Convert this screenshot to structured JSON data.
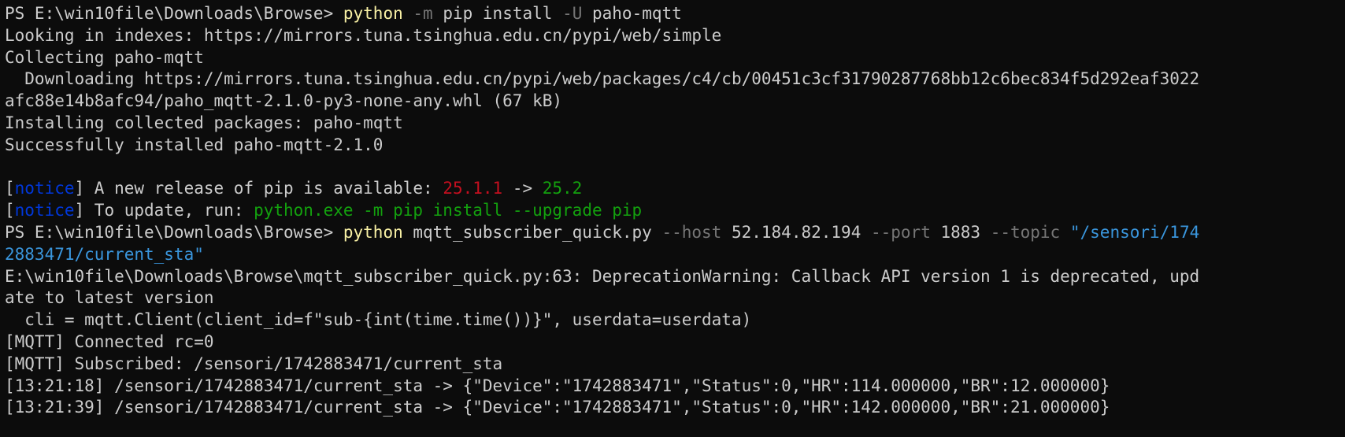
{
  "terminal": {
    "colors": {
      "default": "#cccccc",
      "command": "#f9f1a5",
      "param": "#767676",
      "string": "#3a96dd",
      "notice": "#0037da",
      "old_version": "#c50f1f",
      "new_version": "#13a10e",
      "update_cmd": "#13a10e"
    },
    "lines": [
      [
        {
          "text": "PS E:\\win10file\\Downloads\\Browse> ",
          "color": "#cccccc"
        },
        {
          "text": "python",
          "color": "#f9f1a5"
        },
        {
          "text": " ",
          "color": "#cccccc"
        },
        {
          "text": "-m",
          "color": "#767676"
        },
        {
          "text": " pip install ",
          "color": "#cccccc"
        },
        {
          "text": "-U",
          "color": "#767676"
        },
        {
          "text": " paho-mqtt",
          "color": "#cccccc"
        }
      ],
      [
        {
          "text": "Looking in indexes: https://mirrors.tuna.tsinghua.edu.cn/pypi/web/simple",
          "color": "#cccccc"
        }
      ],
      [
        {
          "text": "Collecting paho-mqtt",
          "color": "#cccccc"
        }
      ],
      [
        {
          "text": "  Downloading https://mirrors.tuna.tsinghua.edu.cn/pypi/web/packages/c4/cb/00451c3cf31790287768bb12c6bec834f5d292eaf3022",
          "color": "#cccccc"
        }
      ],
      [
        {
          "text": "afc88e14b8afc94/paho_mqtt-2.1.0-py3-none-any.whl (67 kB)",
          "color": "#cccccc"
        }
      ],
      [
        {
          "text": "Installing collected packages: paho-mqtt",
          "color": "#cccccc"
        }
      ],
      [
        {
          "text": "Successfully installed paho-mqtt-2.1.0",
          "color": "#cccccc"
        }
      ],
      [],
      [
        {
          "text": "[",
          "color": "#cccccc"
        },
        {
          "text": "notice",
          "color": "#0037da"
        },
        {
          "text": "] A new release of pip is available: ",
          "color": "#cccccc"
        },
        {
          "text": "25.1.1",
          "color": "#c50f1f"
        },
        {
          "text": " -> ",
          "color": "#cccccc"
        },
        {
          "text": "25.2",
          "color": "#13a10e"
        }
      ],
      [
        {
          "text": "[",
          "color": "#cccccc"
        },
        {
          "text": "notice",
          "color": "#0037da"
        },
        {
          "text": "] To update, run: ",
          "color": "#cccccc"
        },
        {
          "text": "python.exe -m pip install --upgrade pip",
          "color": "#13a10e"
        }
      ],
      [
        {
          "text": "PS E:\\win10file\\Downloads\\Browse> ",
          "color": "#cccccc"
        },
        {
          "text": "python",
          "color": "#f9f1a5"
        },
        {
          "text": " mqtt_subscriber_quick.py ",
          "color": "#cccccc"
        },
        {
          "text": "--host",
          "color": "#767676"
        },
        {
          "text": " 52.184.82.194 ",
          "color": "#cccccc"
        },
        {
          "text": "--port",
          "color": "#767676"
        },
        {
          "text": " 1883 ",
          "color": "#cccccc"
        },
        {
          "text": "--topic",
          "color": "#767676"
        },
        {
          "text": " ",
          "color": "#cccccc"
        },
        {
          "text": "\"/sensori/174",
          "color": "#3a96dd"
        }
      ],
      [
        {
          "text": "2883471/current_sta\"",
          "color": "#3a96dd"
        }
      ],
      [
        {
          "text": "E:\\win10file\\Downloads\\Browse\\mqtt_subscriber_quick.py:63: DeprecationWarning: Callback API version 1 is deprecated, upd",
          "color": "#cccccc"
        }
      ],
      [
        {
          "text": "ate to latest version",
          "color": "#cccccc"
        }
      ],
      [
        {
          "text": "  cli = mqtt.Client(client_id=f\"sub-{int(time.time())}\", userdata=userdata)",
          "color": "#cccccc"
        }
      ],
      [
        {
          "text": "[MQTT] Connected rc=0",
          "color": "#cccccc"
        }
      ],
      [
        {
          "text": "[MQTT] Subscribed: /sensori/1742883471/current_sta",
          "color": "#cccccc"
        }
      ],
      [
        {
          "text": "[13:21:18] /sensori/1742883471/current_sta -> {\"Device\":\"1742883471\",\"Status\":0,\"HR\":114.000000,\"BR\":12.000000}",
          "color": "#cccccc"
        }
      ],
      [
        {
          "text": "[13:21:39] /sensori/1742883471/current_sta -> {\"Device\":\"1742883471\",\"Status\":0,\"HR\":142.000000,\"BR\":21.000000}",
          "color": "#cccccc"
        }
      ]
    ]
  }
}
